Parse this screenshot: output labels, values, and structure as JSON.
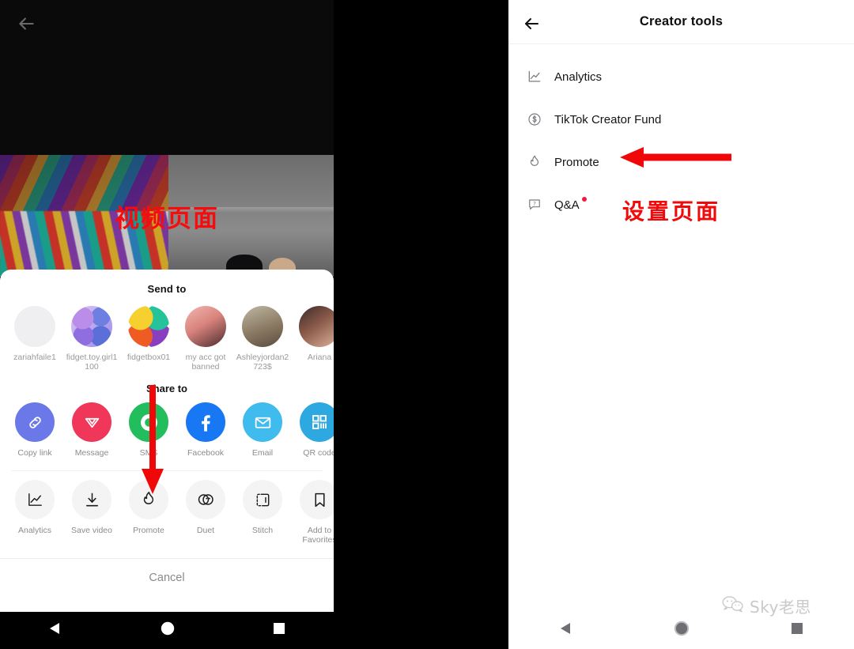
{
  "colors": {
    "annotation_red": "#ef0b0b",
    "tiktok_red": "#f0375a",
    "facebook_blue": "#1877f2",
    "sms_green": "#22bd5c",
    "email_blue": "#3fbbee",
    "qr_blue": "#2ea8e0",
    "copy_link_purple": "#6b79e8",
    "badge_red": "#f4173f"
  },
  "left_panel": {
    "back_icon": "back-arrow-icon",
    "video_overlay_text": "视频页面",
    "share_sheet": {
      "send_to_title": "Send to",
      "contacts": [
        {
          "name": "zariahfaile1",
          "avatar": "blank-avatar"
        },
        {
          "name": "fidget.toy.girl1100",
          "avatar": "glitter-avatar"
        },
        {
          "name": "fidgetbox01",
          "avatar": "rainbow-avatar"
        },
        {
          "name": "my acc got banned",
          "avatar": "face-avatar"
        },
        {
          "name": "Ashleyjordan2723$",
          "avatar": "family-avatar"
        },
        {
          "name": "Ariana",
          "avatar": "woman-avatar"
        }
      ],
      "share_to_title": "Share to",
      "share_targets": [
        {
          "label": "Copy link",
          "icon": "link-icon"
        },
        {
          "label": "Message",
          "icon": "send-plane-icon"
        },
        {
          "label": "SMS",
          "icon": "sms-bubble-icon"
        },
        {
          "label": "Facebook",
          "icon": "facebook-icon"
        },
        {
          "label": "Email",
          "icon": "envelope-icon"
        },
        {
          "label": "QR code",
          "icon": "qr-code-icon"
        }
      ],
      "actions": [
        {
          "label": "Analytics",
          "icon": "chart-line-icon"
        },
        {
          "label": "Save video",
          "icon": "download-icon"
        },
        {
          "label": "Promote",
          "icon": "flame-icon"
        },
        {
          "label": "Duet",
          "icon": "duet-circles-icon"
        },
        {
          "label": "Stitch",
          "icon": "stitch-icon"
        },
        {
          "label": "Add to Favorites",
          "icon": "bookmark-icon"
        }
      ],
      "cancel_label": "Cancel"
    },
    "nav_bar": {
      "back": "triangle-back-icon",
      "home": "circle-home-icon",
      "recents": "square-recents-icon"
    }
  },
  "right_panel": {
    "back_icon": "back-arrow-icon",
    "title": "Creator tools",
    "menu_items": [
      {
        "label": "Analytics",
        "icon": "chart-line-icon",
        "badge": false
      },
      {
        "label": "TikTok Creator Fund",
        "icon": "dollar-circle-icon",
        "badge": false
      },
      {
        "label": "Promote",
        "icon": "flame-icon",
        "badge": false
      },
      {
        "label": "Q&A",
        "icon": "question-bubble-icon",
        "badge": true
      }
    ],
    "annotation_text": "设置页面",
    "nav_bar": {
      "back": "triangle-back-icon",
      "home": "circle-home-icon",
      "recents": "square-recents-icon"
    }
  },
  "watermark": {
    "icon": "wechat-icon",
    "text": "Sky老思"
  }
}
